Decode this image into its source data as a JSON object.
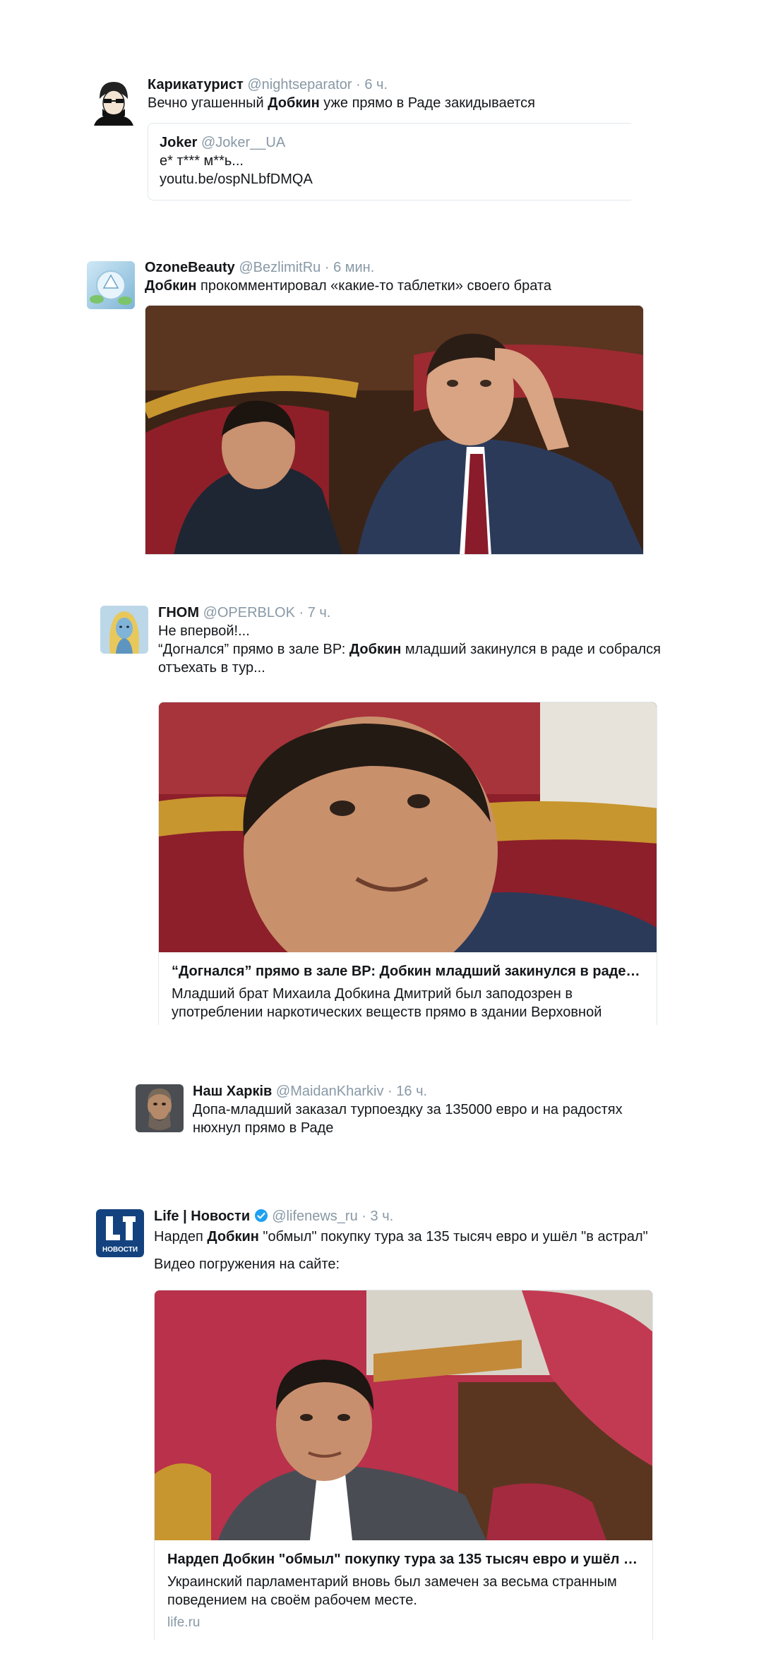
{
  "tweets": [
    {
      "name": "Карикатурист",
      "handle": "@nightseparator",
      "sep": "·",
      "time": "6 ч.",
      "text_before": "Вечно угашенный ",
      "text_bold": "Добкин",
      "text_after": " уже прямо в Раде закидывается",
      "quote": {
        "name": "Joker",
        "handle": "@Joker__UA",
        "line1": "е* т*** м**ь...",
        "line2": "youtu.be/ospNLbfDMQA"
      }
    },
    {
      "name": "OzoneBeauty",
      "handle": "@BezlimitRu",
      "sep": "·",
      "time": "6 мин.",
      "text_bold": "Добкин",
      "text_after": " прокомментировал «какие-то таблетки» своего брата"
    },
    {
      "name": "ГНОМ",
      "handle": "@OPERBLOK",
      "sep": "·",
      "time": "7 ч.",
      "line1": "Не впервой!...",
      "text_before": "“Догнался” прямо в зале ВР: ",
      "text_bold": "Добкин",
      "text_after": " младший закинулся в раде и собрался отъехать в тур...",
      "card": {
        "title": "“Догнался” прямо в зале ВР: Добкин младший закинулся в раде и собрался отъехать в тур",
        "description": "Младший брат Михаила Добкина Дмитрий был заподозрен в употреблении наркотических веществ прямо в здании Верховной Рады..."
      }
    },
    {
      "name": "Наш Харків",
      "handle": "@MaidanKharkiv",
      "sep": "·",
      "time": "16 ч.",
      "text": "Допа-младший заказал турпоездку за 135000 евро и на радостях нюхнул прямо в Раде"
    },
    {
      "name": "Life | Новости",
      "handle": "@lifenews_ru",
      "sep": "·",
      "time": "3 ч.",
      "text_before": "Нардеп ",
      "text_bold": "Добкин",
      "text_after": " \"обмыл\" покупку тура за 135 тысяч евро и ушёл \"в астрал\"",
      "line2": "Видео погружения на сайте:",
      "avatar_text": "НОВОСТИ",
      "card": {
        "title": "Нардеп Добкин \"обмыл\" покупку тура за 135 тысяч евро и ушёл \"в астрал\"",
        "description": "Украинский парламентарий вновь был замечен за весьма странным поведением на своём рабочем месте.",
        "domain": "life.ru"
      }
    }
  ],
  "colors": {
    "text": "#14171a",
    "muted": "#8899a6",
    "border": "#e1e8ed",
    "verified": "#1da1f2",
    "seat_red": "#a8232f",
    "wood": "#c8962e",
    "suit": "#2c3a5a"
  }
}
